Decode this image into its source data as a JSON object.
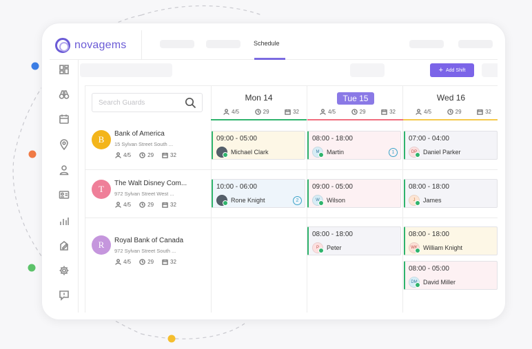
{
  "app": {
    "logo_text": "novagems",
    "nav_active": "Schedule",
    "add_shift_label": "Add Shift",
    "search_placeholder": "Search Guards"
  },
  "colors": {
    "accent": "#7b64e8",
    "mon_bar": "#2fb36c",
    "tue_bar": "#f06e7e",
    "wed_bar": "#f5c84a"
  },
  "days": [
    {
      "name": "Mon 14",
      "active": false,
      "guards": "4/5",
      "hours": "29",
      "shifts": "32"
    },
    {
      "name": "Tue 15",
      "active": true,
      "guards": "4/5",
      "hours": "29",
      "shifts": "32"
    },
    {
      "name": "Wed 16",
      "active": false,
      "guards": "4/5",
      "hours": "29",
      "shifts": "32"
    }
  ],
  "clients": [
    {
      "initial": "B",
      "name": "Bank of America",
      "address": "15 Sylvan Street South ...",
      "guards": "4/5",
      "hours": "29",
      "shifts": "32",
      "color": "#f3b51b"
    },
    {
      "initial": "T",
      "name": "The Walt Disney Com...",
      "address": "972 Sylvan Street West ...",
      "guards": "4/5",
      "hours": "29",
      "shifts": "32",
      "color": "#ef7f99"
    },
    {
      "initial": "R",
      "name": "Royal Bank of Canada",
      "address": "972 Sylvan Street South ...",
      "guards": "4/5",
      "hours": "29",
      "shifts": "32",
      "color": "#c596dd"
    }
  ],
  "shifts": [
    {
      "time": "09:00 - 05:00",
      "person": "Michael Clark",
      "initials": "",
      "badge": "",
      "bg": "#fdf7e6",
      "edge": "#2fb36c",
      "av_bg": "#55606b"
    },
    {
      "time": "08:00 - 18:00",
      "person": "Martin",
      "initials": "M",
      "badge": "1",
      "bg": "#fdf1f3",
      "edge": "#2fb36c",
      "av_bg": "#d7ecf5"
    },
    {
      "time": "07:00 - 04:00",
      "person": "Daniel Parker",
      "initials": "DP",
      "badge": "",
      "bg": "#f4f4f8",
      "edge": "#2fb36c",
      "av_bg": "#fbe0e0"
    },
    {
      "time": "10:00 - 06:00",
      "person": "Rone Knight",
      "initials": "",
      "badge": "2",
      "bg": "#eef5fb",
      "edge": "#2fb36c",
      "av_bg": "#55606b"
    },
    {
      "time": "09:00 - 05:00",
      "person": "Wilson",
      "initials": "W",
      "badge": "",
      "bg": "#fdf1f3",
      "edge": "#2fb36c",
      "av_bg": "#d7ecf5"
    },
    {
      "time": "08:00 - 18:00",
      "person": "James",
      "initials": "J",
      "badge": "",
      "bg": "#f4f4f8",
      "edge": "#2fb36c",
      "av_bg": "#fde5d4"
    },
    {
      "time": "08:00 - 18:00",
      "person": "Peter",
      "initials": "P",
      "badge": "",
      "bg": "#f4f4f8",
      "edge": "#2fb36c",
      "av_bg": "#fde0e0"
    },
    {
      "time": "08:00 - 18:00",
      "person": "William Knight",
      "initials": "WK",
      "badge": "",
      "bg": "#fdf7e6",
      "edge": "#2fb36c",
      "av_bg": "#fde0d6"
    },
    {
      "time": "08:00 - 05:00",
      "person": "David Miller",
      "initials": "DM",
      "badge": "",
      "bg": "#fdf1f3",
      "edge": "#2fb36c",
      "av_bg": "#d6eef7"
    }
  ]
}
